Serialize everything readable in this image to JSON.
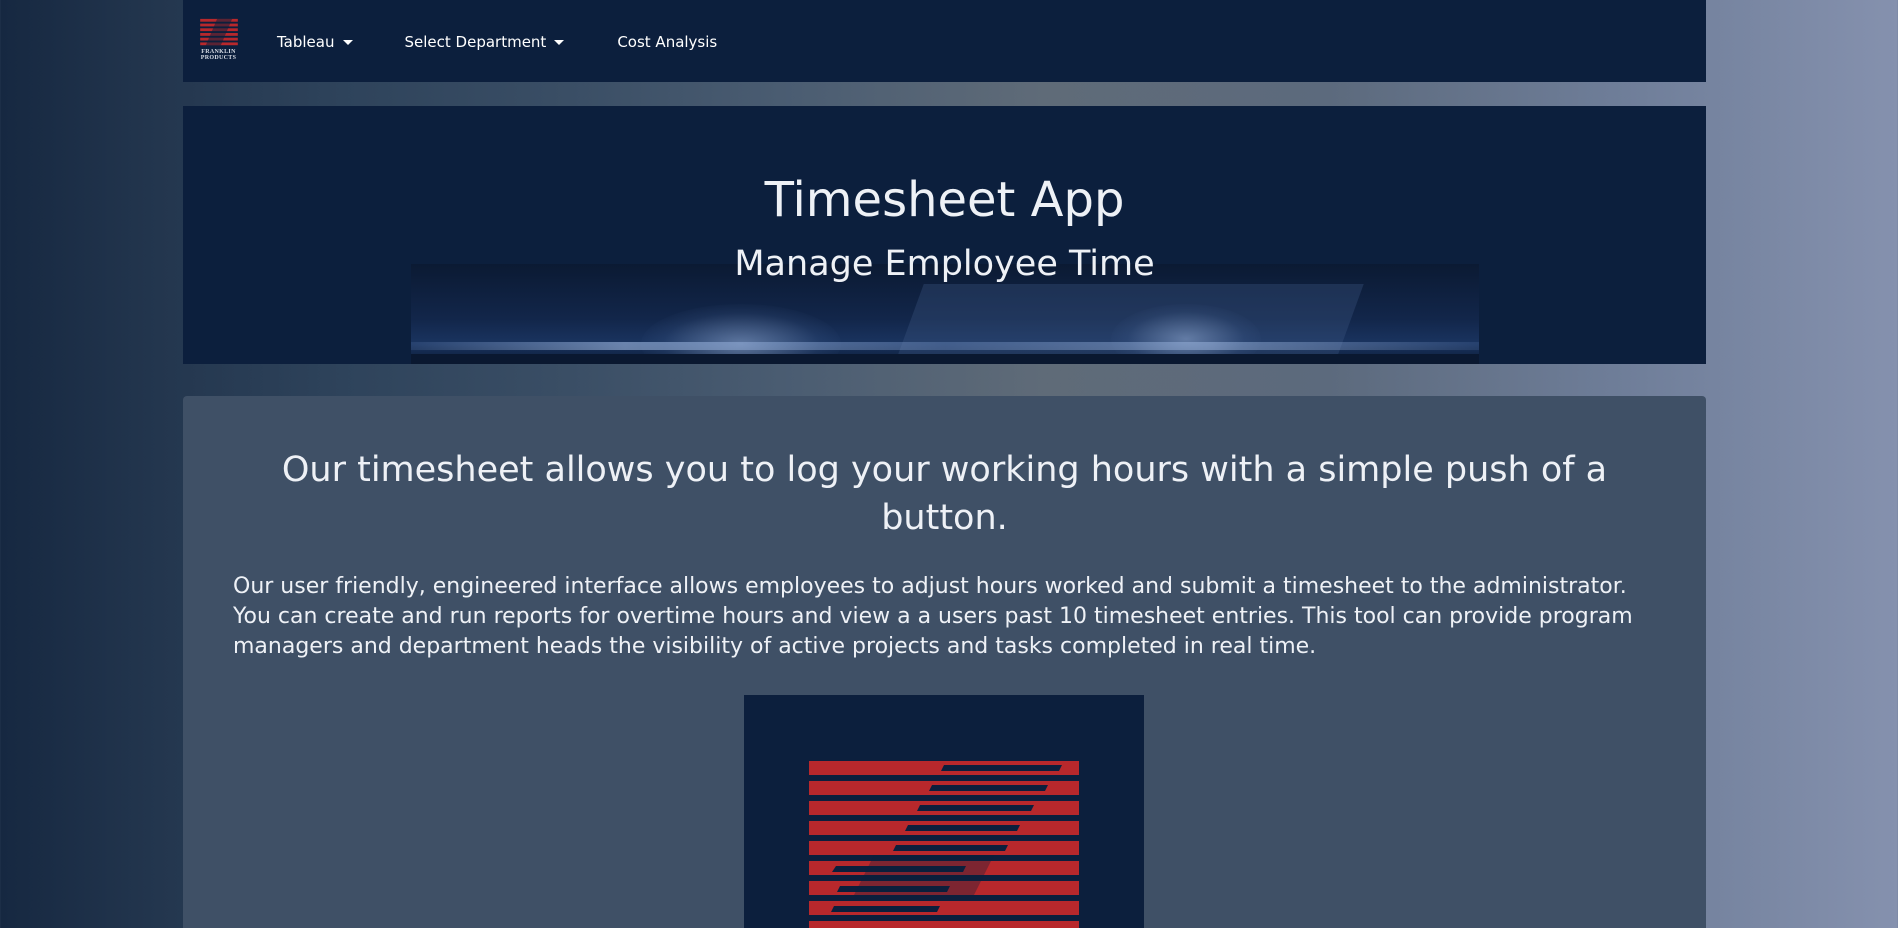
{
  "navbar": {
    "brand_text_line1": "FRANKLIN",
    "brand_text_line2": "PRODUCTS",
    "items": [
      {
        "label": "Tableau",
        "has_dropdown": true
      },
      {
        "label": "Select Department",
        "has_dropdown": true
      },
      {
        "label": "Cost Analysis",
        "has_dropdown": false
      }
    ]
  },
  "hero": {
    "title": "Timesheet App",
    "subtitle": "Manage Employee Time"
  },
  "content": {
    "heading": "Our timesheet allows you to log your working hours with a simple push of a button.",
    "body": "Our user friendly, engineered interface allows employees to adjust hours worked and submit a timesheet to the administrator. You can create and run reports for overtime hours and view a a users past 10 timesheet entries. This tool can provide program managers and department heads the visibility of active projects and tasks completed in real time."
  },
  "colors": {
    "navbar_bg": "#0c1f3d",
    "logo_red": "#b8282c",
    "card_bg": "#3f5066",
    "text": "#eef1f6"
  },
  "icons": {
    "brand_logo": "franklin-products-logo",
    "dropdown_caret": "caret-down-icon",
    "content_logo": "franklin-stripes-logo"
  }
}
